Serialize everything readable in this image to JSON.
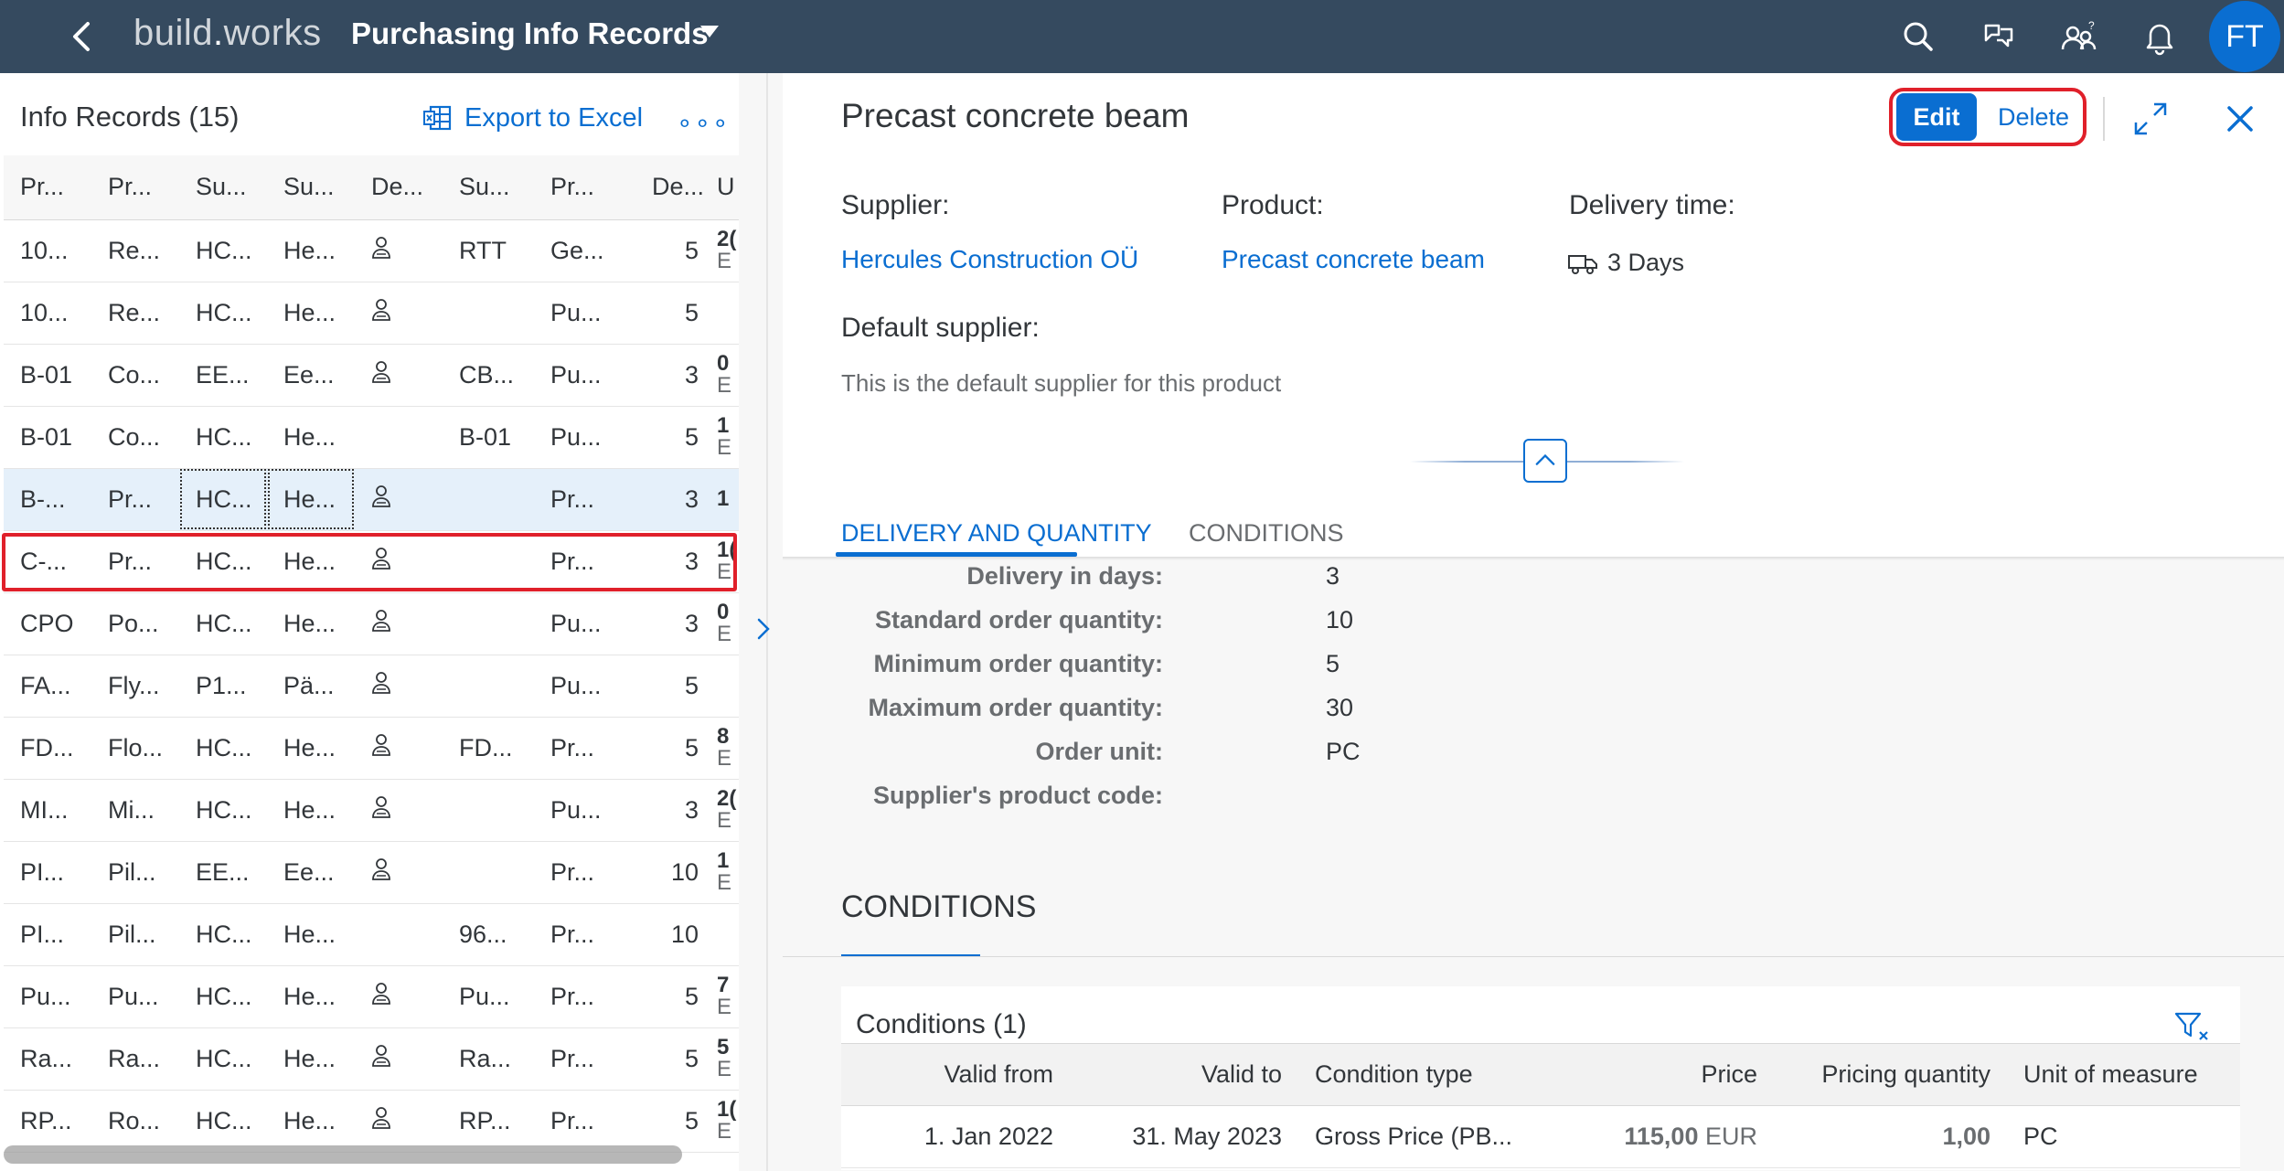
{
  "shell": {
    "logo_prefix": "build",
    "logo_dot": ".",
    "logo_suffix": "works",
    "app_title": "Purchasing Info Records",
    "avatar_initials": "FT",
    "icons": [
      "back-icon",
      "search-icon",
      "copilot-icon",
      "users-icon",
      "bell-icon"
    ],
    "bar_color": "#354a5f",
    "accent_color": "#0a6ed1"
  },
  "list": {
    "count_label": "Info Records (15)",
    "export_label": "Export to Excel",
    "more_label": "∘∘∘",
    "columns": [
      "Pr...",
      "Pr...",
      "Su...",
      "Su...",
      "De...",
      "Su...",
      "Pr...",
      "De...",
      "U"
    ],
    "rows": [
      {
        "c1": "10...",
        "c2": "Re...",
        "c3": "HC...",
        "c4": "He...",
        "default": true,
        "c6": "RTT",
        "c7": "Ge...",
        "c8": "5",
        "u1": "2(",
        "u2": "E"
      },
      {
        "c1": "10...",
        "c2": "Re...",
        "c3": "HC...",
        "c4": "He...",
        "default": true,
        "c6": "",
        "c7": "Pu...",
        "c8": "5",
        "u1": "",
        "u2": ""
      },
      {
        "c1": "B-01",
        "c2": "Co...",
        "c3": "EE...",
        "c4": "Ee...",
        "default": true,
        "c6": "CB...",
        "c7": "Pu...",
        "c8": "3",
        "u1": "0",
        "u2": "E"
      },
      {
        "c1": "B-01",
        "c2": "Co...",
        "c3": "HC...",
        "c4": "He...",
        "default": false,
        "c6": "B-01",
        "c7": "Pu...",
        "c8": "5",
        "u1": "1",
        "u2": "E"
      },
      {
        "c1": "B-...",
        "c2": "Pr...",
        "c3": "HC...",
        "c4": "He...",
        "default": true,
        "c6": "",
        "c7": "Pr...",
        "c8": "3",
        "u1": "1",
        "u2": ""
      },
      {
        "c1": "C-...",
        "c2": "Pr...",
        "c3": "HC...",
        "c4": "He...",
        "default": true,
        "c6": "",
        "c7": "Pr...",
        "c8": "3",
        "u1": "1(",
        "u2": "E"
      },
      {
        "c1": "CPO",
        "c2": "Po...",
        "c3": "HC...",
        "c4": "He...",
        "default": true,
        "c6": "",
        "c7": "Pu...",
        "c8": "3",
        "u1": "0",
        "u2": "E"
      },
      {
        "c1": "FA...",
        "c2": "Fly...",
        "c3": "P1...",
        "c4": "Pä...",
        "default": true,
        "c6": "",
        "c7": "Pu...",
        "c8": "5",
        "u1": "",
        "u2": ""
      },
      {
        "c1": "FD...",
        "c2": "Flo...",
        "c3": "HC...",
        "c4": "He...",
        "default": true,
        "c6": "FD...",
        "c7": "Pr...",
        "c8": "5",
        "u1": "8",
        "u2": "E"
      },
      {
        "c1": "MI...",
        "c2": "Mi...",
        "c3": "HC...",
        "c4": "He...",
        "default": true,
        "c6": "",
        "c7": "Pu...",
        "c8": "3",
        "u1": "2(",
        "u2": "E"
      },
      {
        "c1": "PI...",
        "c2": "Pil...",
        "c3": "EE...",
        "c4": "Ee...",
        "default": true,
        "c6": "",
        "c7": "Pr...",
        "c8": "10",
        "u1": "1",
        "u2": "E"
      },
      {
        "c1": "PI...",
        "c2": "Pil...",
        "c3": "HC...",
        "c4": "He...",
        "default": false,
        "c6": "96...",
        "c7": "Pr...",
        "c8": "10",
        "u1": "",
        "u2": ""
      },
      {
        "c1": "Pu...",
        "c2": "Pu...",
        "c3": "HC...",
        "c4": "He...",
        "default": true,
        "c6": "Pu...",
        "c7": "Pr...",
        "c8": "5",
        "u1": "7",
        "u2": "E"
      },
      {
        "c1": "Ra...",
        "c2": "Ra...",
        "c3": "HC...",
        "c4": "He...",
        "default": true,
        "c6": "Ra...",
        "c7": "Pr...",
        "c8": "5",
        "u1": "5",
        "u2": "E"
      },
      {
        "c1": "RP...",
        "c2": "Ro...",
        "c3": "HC...",
        "c4": "He...",
        "default": true,
        "c6": "RP...",
        "c7": "Pr...",
        "c8": "5",
        "u1": "1(",
        "u2": "E"
      }
    ],
    "selected_row_index": 4
  },
  "object": {
    "title": "Precast concrete beam",
    "edit_label": "Edit",
    "delete_label": "Delete",
    "supplier_label": "Supplier:",
    "supplier_value": "Hercules Construction OÜ",
    "product_label": "Product:",
    "product_value": "Precast concrete beam",
    "delivery_label": "Delivery time:",
    "delivery_value": "3 Days",
    "default_supplier_label": "Default supplier:",
    "default_supplier_value": "This is the default supplier for this product",
    "tabs": [
      {
        "label": "DELIVERY AND QUANTITY",
        "active": true
      },
      {
        "label": "CONDITIONS",
        "active": false
      }
    ],
    "delivery_fields": [
      {
        "label": "Delivery in days:",
        "value": "3"
      },
      {
        "label": "Standard order quantity:",
        "value": "10"
      },
      {
        "label": "Minimum order quantity:",
        "value": "5"
      },
      {
        "label": "Maximum order quantity:",
        "value": "30"
      },
      {
        "label": "Order unit:",
        "value": "PC"
      },
      {
        "label": "Supplier's product code:",
        "value": ""
      }
    ],
    "conditions_section_title": "CONDITIONS",
    "conditions_table_title": "Conditions (1)",
    "conditions_columns": [
      "Valid from",
      "Valid to",
      "Condition type",
      "Price",
      "Pricing quantity",
      "Unit of measure"
    ],
    "conditions_rows": [
      {
        "valid_from": "1. Jan 2022",
        "valid_to": "31. May 2023",
        "condition_type": "Gross Price (PB...",
        "price": "115,00",
        "currency": "EUR",
        "pricing_quantity": "1,00",
        "unit": "PC"
      }
    ]
  }
}
